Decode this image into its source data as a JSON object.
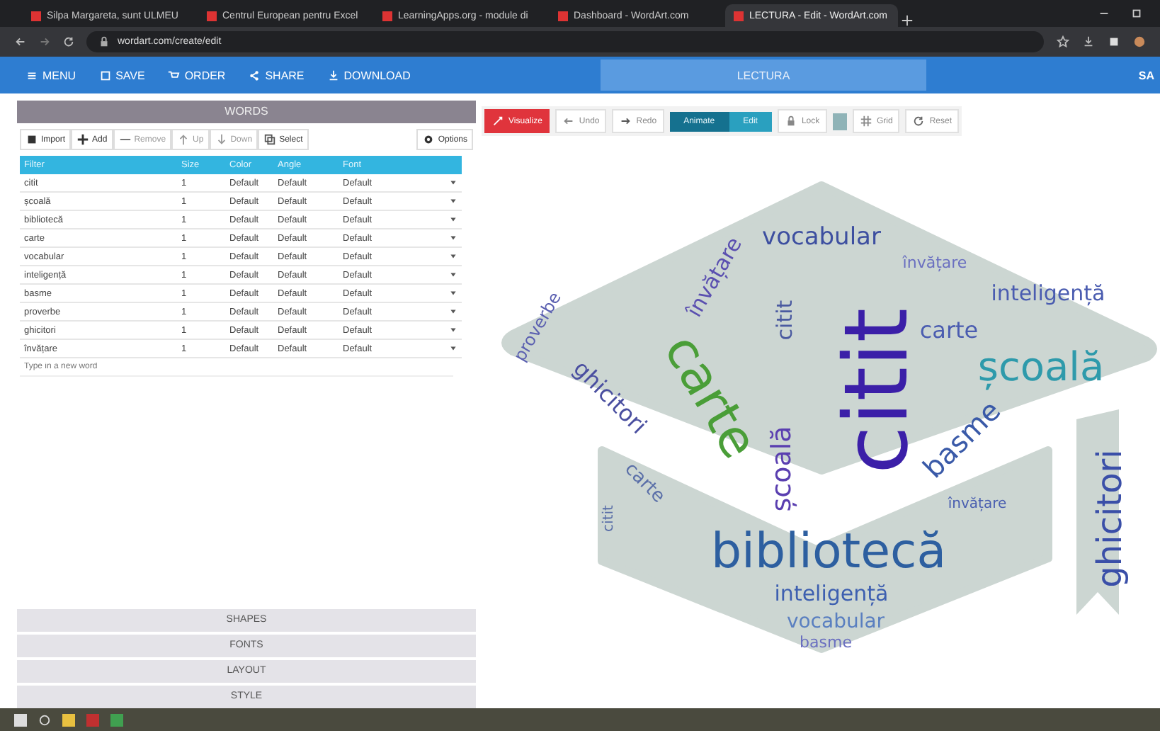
{
  "browser": {
    "tabs": [
      {
        "label": "Silpa Margareta, sunt ULMEU",
        "selected": false
      },
      {
        "label": "Centrul European pentru Excel",
        "selected": false
      },
      {
        "label": "LearningApps.org - module di",
        "selected": false
      },
      {
        "label": "Dashboard - WordArt.com",
        "selected": false
      },
      {
        "label": "LECTURA - Edit - WordArt.com",
        "selected": true
      }
    ],
    "address": "wordart.com/create/edit"
  },
  "app_bar": {
    "menu": [
      {
        "label": "MENU"
      },
      {
        "label": "SAVE"
      },
      {
        "label": "ORDER"
      },
      {
        "label": "SHARE"
      },
      {
        "label": "DOWNLOAD"
      }
    ],
    "title": "LECTURA",
    "right": "SA"
  },
  "words_panel": {
    "title": "WORDS",
    "tools": [
      {
        "label": "Import"
      },
      {
        "label": "Add"
      },
      {
        "label": "Remove"
      },
      {
        "label": "Up"
      },
      {
        "label": "Down"
      },
      {
        "label": "Select"
      }
    ],
    "options": "Options",
    "columns": [
      "Filter",
      "Size",
      "Color",
      "Angle",
      "Font"
    ],
    "rows": [
      [
        "citit",
        "1",
        "Default",
        "Default",
        "Default"
      ],
      [
        "școală",
        "1",
        "Default",
        "Default",
        "Default"
      ],
      [
        "bibliotecă",
        "1",
        "Default",
        "Default",
        "Default"
      ],
      [
        "carte",
        "1",
        "Default",
        "Default",
        "Default"
      ],
      [
        "vocabular",
        "1",
        "Default",
        "Default",
        "Default"
      ],
      [
        "inteligență",
        "1",
        "Default",
        "Default",
        "Default"
      ],
      [
        "basme",
        "1",
        "Default",
        "Default",
        "Default"
      ],
      [
        "proverbe",
        "1",
        "Default",
        "Default",
        "Default"
      ],
      [
        "ghicitori",
        "1",
        "Default",
        "Default",
        "Default"
      ],
      [
        "învățare",
        "1",
        "Default",
        "Default",
        "Default"
      ]
    ],
    "placeholder": "Type in a new word"
  },
  "sections": [
    "SHAPES",
    "FONTS",
    "LAYOUT",
    "STYLE"
  ],
  "canvas_toolbar": {
    "visualize": "Visualize",
    "undo": "Undo",
    "redo": "Redo",
    "modes": [
      {
        "label": "Animate",
        "selected": true
      },
      {
        "label": "Edit",
        "selected": false
      }
    ],
    "lock": "Lock",
    "grid": "Grid",
    "reset": "Reset"
  },
  "word_cloud": [
    {
      "text": "școală",
      "color": "#2e9aab"
    },
    {
      "text": "carte",
      "color": "#4a9e38"
    },
    {
      "text": "citit",
      "color": "#3b1fa8"
    },
    {
      "text": "bibliotecă",
      "color": "#2d5fa0"
    },
    {
      "text": "ghicitori",
      "color": "#3a4fa8"
    },
    {
      "text": "inteligență",
      "color": "#4a5cb0"
    },
    {
      "text": "vocabular",
      "color": "#3d4fa0"
    },
    {
      "text": "basme",
      "color": "#3a5aa8"
    },
    {
      "text": "carte",
      "color": "#4a5cb0"
    },
    {
      "text": "școală",
      "color": "#5a3fb0"
    },
    {
      "text": "învățare",
      "color": "#5a4fb0"
    },
    {
      "text": "ghicitori",
      "color": "#4a4fa0"
    },
    {
      "text": "proverbe",
      "color": "#5a5fb0"
    },
    {
      "text": "citit",
      "color": "#4a5aa0"
    },
    {
      "text": "inteligență",
      "color": "#3d5fb0"
    },
    {
      "text": "vocabular",
      "color": "#5a7fc0"
    },
    {
      "text": "basme",
      "color": "#6a6fc0"
    },
    {
      "text": "carte",
      "color": "#5a6fa8"
    },
    {
      "text": "învățare",
      "color": "#6a6fc0"
    },
    {
      "text": "învățare",
      "color": "#4a5fb0"
    },
    {
      "text": "citit",
      "color": "#5a6fa8"
    }
  ]
}
